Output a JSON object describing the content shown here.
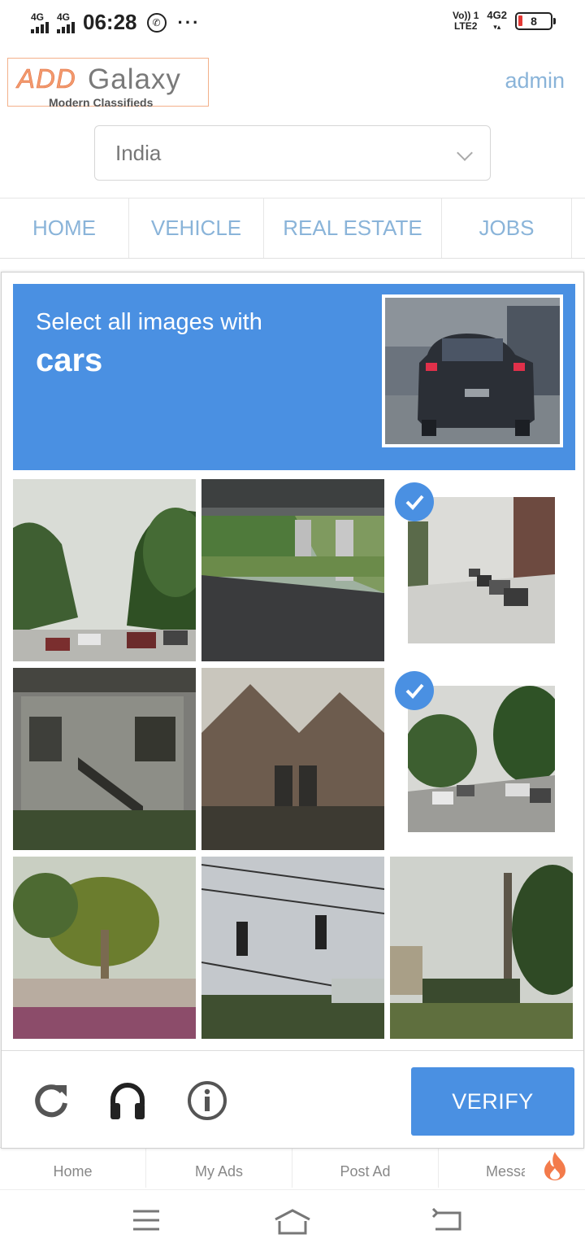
{
  "status_bar": {
    "signal1": "4G",
    "signal2": "4G",
    "time": "06:28",
    "volte": "Vo)) 1",
    "lte": "LTE2",
    "net": "4G2",
    "battery": "8"
  },
  "header": {
    "logo_add": "ADD",
    "logo_galaxy": "Galaxy",
    "logo_tagline": "Modern Classifieds",
    "admin_link": "admin"
  },
  "country_select": {
    "value": "India"
  },
  "nav": [
    "HOME",
    "VEHICLE",
    "REAL ESTATE",
    "JOBS"
  ],
  "captcha": {
    "prompt_line1": "Select all images with",
    "prompt_target": "cars",
    "verify_label": "VERIFY",
    "accent_color": "#4a90e2",
    "tiles_selected": [
      false,
      false,
      true,
      false,
      false,
      true,
      false,
      false,
      false
    ]
  },
  "bottom_tabs": [
    "Home",
    "My Ads",
    "Post Ad",
    "Messag"
  ],
  "icons": {
    "reload": "reload-icon",
    "audio": "headphones-icon",
    "info": "info-icon",
    "fire": "fire-icon"
  }
}
